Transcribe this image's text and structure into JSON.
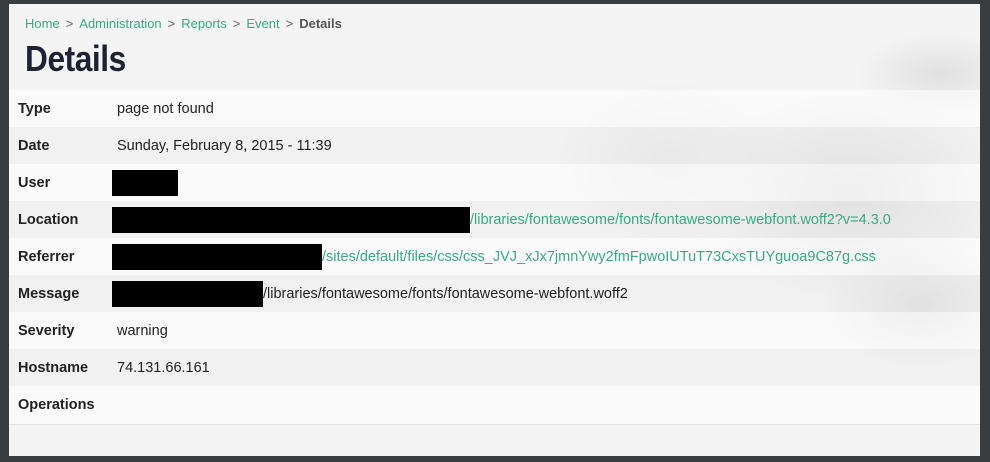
{
  "breadcrumb": {
    "items": [
      "Home",
      "Administration",
      "Reports",
      "Event"
    ],
    "separator": ">",
    "current": "Details"
  },
  "page_title": "Details",
  "details": {
    "type_label": "Type",
    "type_value": "page not found",
    "date_label": "Date",
    "date_value": "Sunday, February 8, 2015 - 11:39",
    "user_label": "User",
    "location_label": "Location",
    "location_link": "/libraries/fontawesome/fonts/fontawesome-webfont.woff2?v=4.3.0",
    "referrer_label": "Referrer",
    "referrer_link": "/sites/default/files/css/css_JVJ_xJx7jmnYwy2fmFpwoIUTuT73CxsTUYguoa9C87g.css",
    "message_label": "Message",
    "message_value": "/libraries/fontawesome/fonts/fontawesome-webfont.woff2",
    "severity_label": "Severity",
    "severity_value": "warning",
    "hostname_label": "Hostname",
    "hostname_value": "74.131.66.161",
    "operations_label": "Operations"
  },
  "colors": {
    "link": "#3aaa83",
    "title": "#1f2233"
  }
}
